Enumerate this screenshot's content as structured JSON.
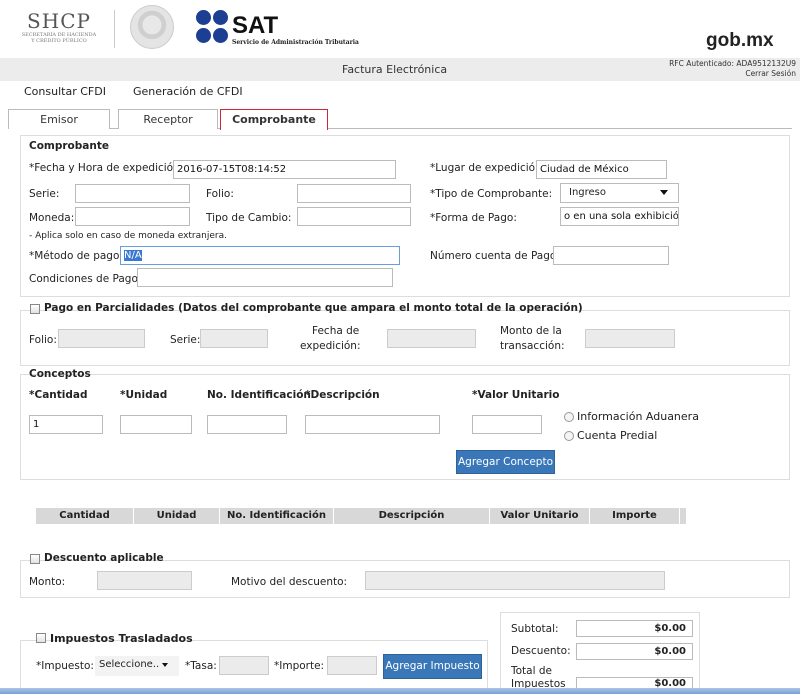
{
  "header": {
    "shcp_logo": "SHCP",
    "shcp_sub1": "SECRETARÍA DE HACIENDA",
    "shcp_sub2": "Y CRÉDITO PÚBLICO",
    "sat_logo": "SAT",
    "sat_sub": "Servicio de Administración Tributaria",
    "gob_logo": "gob.mx",
    "title": "Factura Electrónica",
    "rfc": "RFC Autenticado: ADA9512132U9",
    "logout": "Cerrar Sesión"
  },
  "menu": {
    "consultar": "Consultar CFDI",
    "generacion": "Generación de CFDI"
  },
  "tabs": [
    {
      "label": "Emisor"
    },
    {
      "label": "Receptor"
    },
    {
      "label": "Comprobante"
    }
  ],
  "comprobante": {
    "section_title": "Comprobante",
    "fecha_label": "*Fecha y Hora de expedición:",
    "fecha_value": "2016-07-15T08:14:52",
    "lugar_label": "*Lugar de expedición:",
    "lugar_value": "Ciudad de México",
    "serie_label": "Serie:",
    "folio_label": "Folio:",
    "tipo_label": "*Tipo de Comprobante:",
    "tipo_value": "Ingreso",
    "moneda_label": "Moneda:",
    "tipo_cambio_label": "Tipo de Cambio:",
    "forma_label": "*Forma de Pago:",
    "forma_value": "o en una sola exhibición",
    "note": "- Aplica solo en caso de moneda extranjera.",
    "metodo_label": "*Método de pago:",
    "metodo_value": "N/A",
    "cuenta_label": "Número cuenta de Pago:",
    "condiciones_label": "Condiciones de Pago:"
  },
  "parcialidades": {
    "title": "Pago en Parcialidades (Datos del comprobante que ampara el monto total de la operación)",
    "folio_label": "Folio:",
    "serie_label": "Serie:",
    "fecha_label_1": "Fecha de",
    "fecha_label_2": "expedición:",
    "monto_label_1": "Monto de la",
    "monto_label_2": "transacción:"
  },
  "conceptos": {
    "title": "Conceptos",
    "cantidad_label": "*Cantidad",
    "unidad_label": "*Unidad",
    "no_id_label": "No. Identificación",
    "descripcion_label": "*Descripción",
    "valor_label": "*Valor Unitario",
    "cantidad_value": "1",
    "info_aduanera": "Información Aduanera",
    "cuenta_predial": "Cuenta Predial",
    "agregar_btn": "Agregar Concepto"
  },
  "table_headers": [
    "Cantidad",
    "Unidad",
    "No. Identificación",
    "Descripción",
    "Valor Unitario",
    "Importe"
  ],
  "descuento": {
    "title": "Descuento aplicable",
    "monto_label": "Monto:",
    "motivo_label": "Motivo del descuento:"
  },
  "impuestos": {
    "title": "Impuestos Trasladados",
    "impuesto_label": "*Impuesto:",
    "impuesto_value": "Seleccione..",
    "tasa_label": "*Tasa:",
    "importe_label": "*Importe:",
    "agregar_btn": "Agregar Impuesto"
  },
  "totales": {
    "subtotal_label": "Subtotal:",
    "subtotal_value": "$0.00",
    "descuento_label": "Descuento:",
    "descuento_value": "$0.00",
    "total_imp_label_1": "Total de",
    "total_imp_label_2": "Impuestos",
    "total_imp_value": "$0.00"
  },
  "colors": {
    "accent": "#3a77b8",
    "active_tab": "#c9293a",
    "sat_blue": "#1c3f94"
  }
}
